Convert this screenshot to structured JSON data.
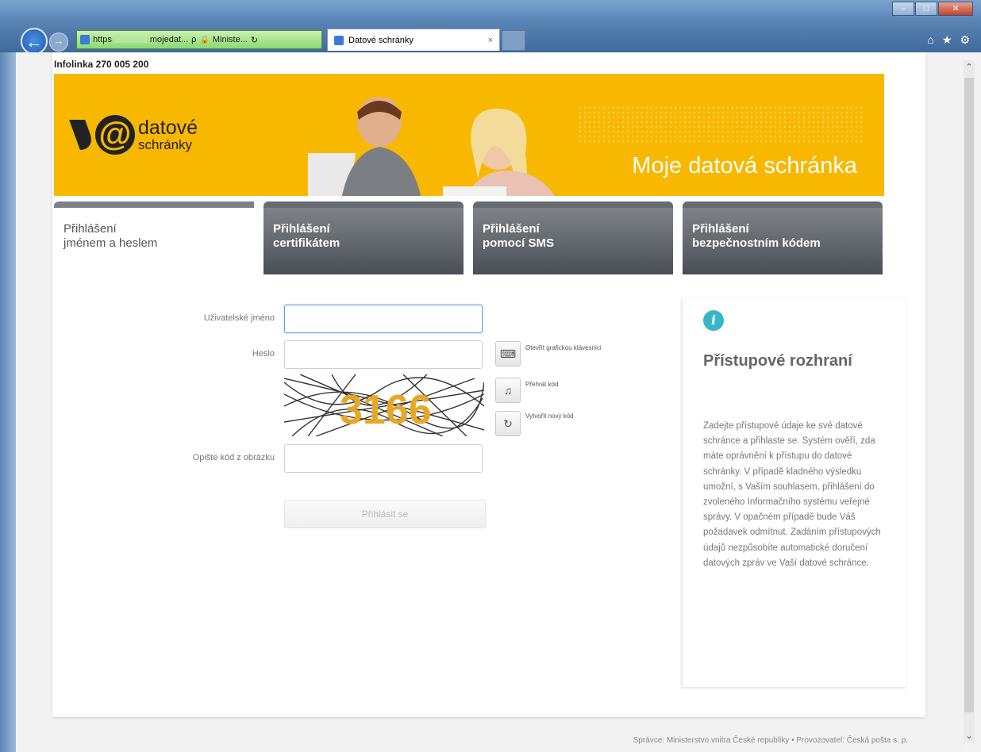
{
  "browser": {
    "address_prefix": "https",
    "address_domain": "mojedat...",
    "address_search": "ρ",
    "address_site": "Ministe...",
    "tab_title": "Datové schránky",
    "tab_close": "×"
  },
  "header": {
    "infoline": "Infolinka 270 005 200"
  },
  "banner": {
    "logo_line1": "datové",
    "logo_line2": "schránky",
    "title": "Moje datová schránka"
  },
  "tabs": [
    {
      "line1": "Přihlášení",
      "line2": "jménem a heslem"
    },
    {
      "line1": "Přihlášení",
      "line2": "certifikátem"
    },
    {
      "line1": "Přihlášení",
      "line2": "pomocí SMS"
    },
    {
      "line1": "Přihlášení",
      "line2": "bezpečnostním kódem"
    }
  ],
  "form": {
    "username_label": "Uživatelské jméno",
    "username_value": "",
    "password_label": "Heslo",
    "password_value": "",
    "keyboard_label": "Otevřít grafickou klávesnici",
    "play_label": "Přehrát kód",
    "refresh_label": "Vytvořit nový kód",
    "captcha_text": "3166",
    "captcha_label": "Opište kód z obrázku",
    "captcha_value": "",
    "submit_label": "Přihlásit se"
  },
  "info": {
    "icon": "i",
    "title": "Přístupové rozhraní",
    "text": "Zadejte přístupové údaje ke své datové schránce a přihlaste se. Systém ověří, zda máte oprávnění k přístupu do datové schránky. V případě kladného výsledku umožní, s Vaším souhlasem, přihlášení do zvoleného Informačního systému veřejné správy. V opačném případě bude Váš požadavek odmítnut. Zadáním přístupových údajů nezpůsobíte automatické doručení datových zpráv ve Vaší datové schránce."
  },
  "footer": {
    "text": "Správce: Ministerstvo vnitra České republiky • Provozovatel: Česká pošta s. p."
  }
}
